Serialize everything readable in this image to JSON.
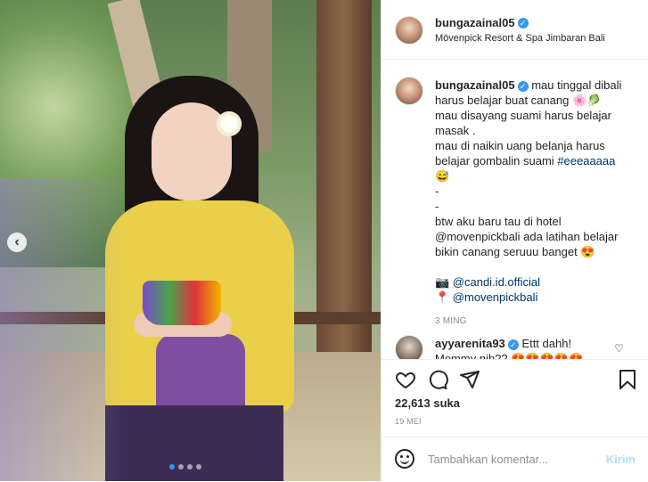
{
  "header": {
    "username": "bungazainal05",
    "location": "Mövenpick Resort & Spa Jimbaran Bali"
  },
  "caption": {
    "username": "bungazainal05",
    "lines": [
      "mau tinggal dibali",
      "harus belajar buat canang 🌸🥬",
      "mau disayang suami harus belajar",
      "masak .",
      "mau di naikin uang belanja harus",
      "belajar gombalin suami #eeeaaaaa",
      "😅",
      "-",
      "-",
      "btw aku baru tau di hotel",
      "@movenpickbali ada latihan belajar",
      "bikin canang seruuu banget 😍",
      "",
      "📷 @candi.id.official",
      "📍 @movenpickbali"
    ],
    "hashtag": "#eeeaaaaa",
    "time": "3 ming"
  },
  "comment": {
    "username": "ayyarenita93",
    "text_line1": "Ettt dahh!",
    "text_line2": "Mommy nih?? 😍😍😍😍😍"
  },
  "actions": {
    "likes": "22,613 suka",
    "date": "19 MEI"
  },
  "composer": {
    "placeholder": "Tambahkan komentar...",
    "post_label": "Kirim"
  },
  "icons": {
    "like": "heart-icon",
    "comment": "comment-icon",
    "share": "share-icon",
    "save": "bookmark-icon",
    "emoji": "emoji-icon",
    "verified": "verified-badge-icon",
    "prev": "chevron-left-icon"
  },
  "carousel": {
    "total": 4,
    "active": 1
  }
}
